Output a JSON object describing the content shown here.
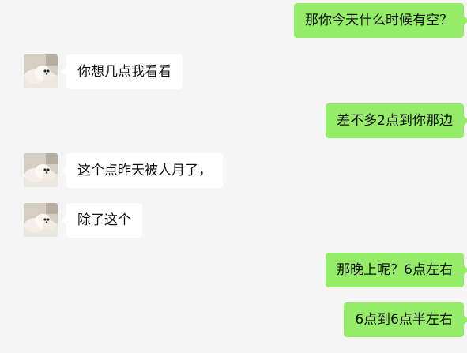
{
  "messages": [
    {
      "side": "out",
      "text": "那你今天什么时候有空？"
    },
    {
      "side": "in",
      "text": "你想几点我看看"
    },
    {
      "side": "out",
      "text": "差不多2点到你那边"
    },
    {
      "side": "in",
      "text": "这个点昨天被人月了，"
    },
    {
      "side": "in",
      "text": "除了这个"
    },
    {
      "side": "out",
      "text": "那晚上呢？6点左右"
    },
    {
      "side": "out",
      "text": "6点到6点半左右"
    }
  ],
  "colors": {
    "outgoing_bubble": "#95ec69",
    "incoming_bubble": "#ffffff",
    "background": "#f5f5f5"
  },
  "icons": {
    "avatar": "dog-photo-avatar"
  }
}
